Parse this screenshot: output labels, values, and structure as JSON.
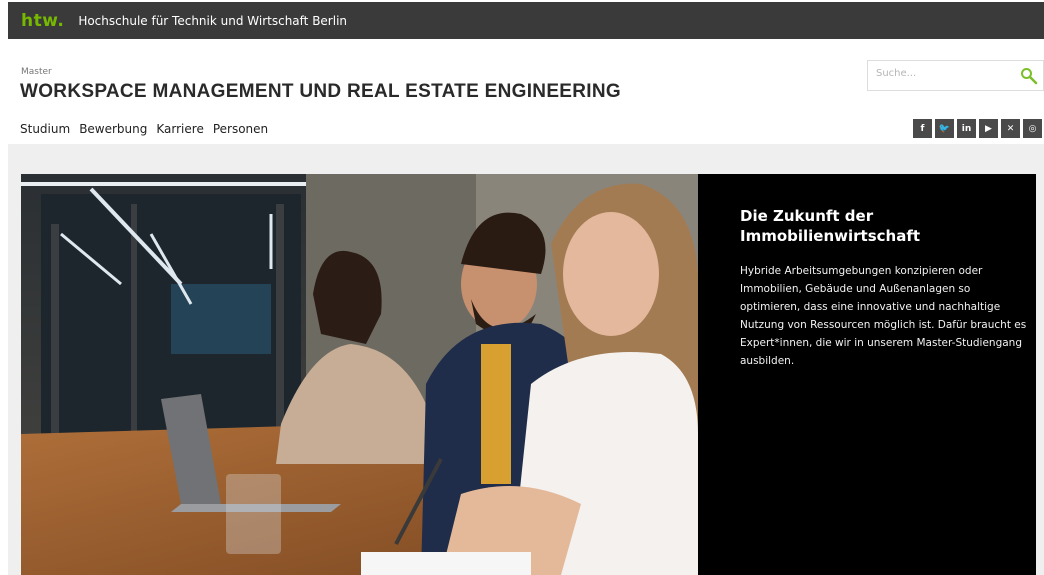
{
  "topbar": {
    "logo": "htw.",
    "institution": "Hochschule für Technik und Wirtschaft Berlin"
  },
  "header": {
    "overline": "Master",
    "title": "WORKSPACE MANAGEMENT UND REAL ESTATE ENGINEERING"
  },
  "search": {
    "placeholder": "Suche..."
  },
  "nav": {
    "items": [
      "Studium",
      "Bewerbung",
      "Karriere",
      "Personen"
    ]
  },
  "social": {
    "icons": [
      {
        "name": "facebook-icon",
        "glyph": "f"
      },
      {
        "name": "twitter-icon",
        "glyph": "🐦"
      },
      {
        "name": "linkedin-icon",
        "glyph": "in"
      },
      {
        "name": "youtube-icon",
        "glyph": "▶"
      },
      {
        "name": "xing-icon",
        "glyph": "✕"
      },
      {
        "name": "instagram-icon",
        "glyph": "◎"
      }
    ]
  },
  "hero": {
    "title": "Die Zukunft der Immobilienwirtschaft",
    "body": "Hybride Arbeitsumgebungen konzipieren oder Immobilien, Gebäude und Außenanlagen so optimieren, dass eine innovative und nachhaltige Nutzung von Ressourcen möglich ist. Dafür braucht es Expert*innen, die wir in unserem Master-Studiengang ausbilden."
  },
  "colors": {
    "brand_green": "#76b900",
    "topbar_bg": "#3a3a3a",
    "hero_panel_bg": "#000000",
    "social_bg": "#4a4a4a"
  }
}
